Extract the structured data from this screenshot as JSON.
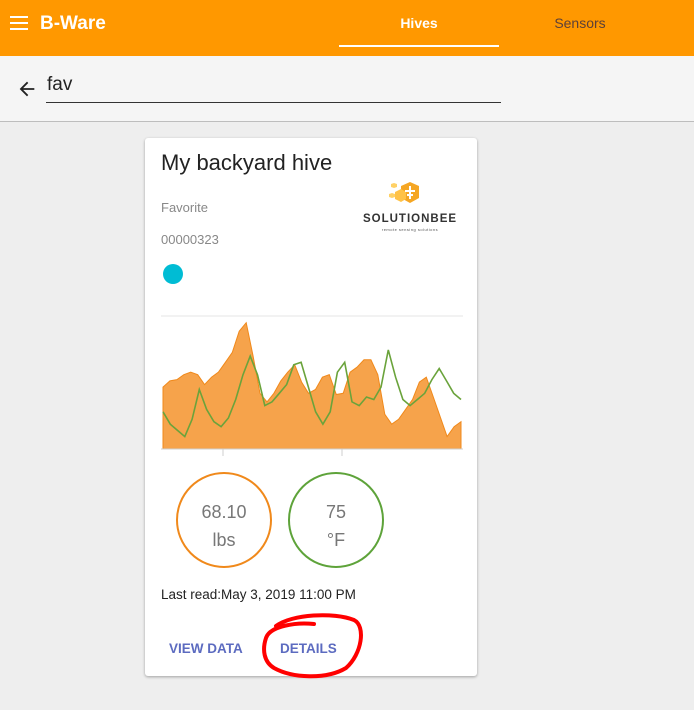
{
  "app": {
    "title": "B-Ware"
  },
  "tabs": [
    {
      "label": "Hives",
      "active": true
    },
    {
      "label": "Sensors",
      "active": false
    }
  ],
  "search": {
    "value": "fav"
  },
  "card": {
    "name": "My backyard hive",
    "subtitle": "Favorite",
    "id": "00000323",
    "status_color": "#00bcd4",
    "logo": {
      "name": "SOLUTIONBEE",
      "tagline": "remote sensing solutions"
    },
    "gauges": [
      {
        "value": "68.10",
        "unit": "lbs",
        "color": "#f0891b"
      },
      {
        "value": "75",
        "unit": "°F",
        "color": "#5ea33a"
      }
    ],
    "last_read": "Last read:May 3, 2019 11:00 PM",
    "actions": {
      "view_data": "VIEW DATA",
      "details": "DETAILS"
    }
  },
  "chart_data": {
    "type": "area",
    "x": [
      0,
      1,
      2,
      3,
      4,
      5,
      6,
      7,
      8,
      9,
      10,
      11,
      12,
      13,
      14,
      15,
      16,
      17,
      18,
      19,
      20,
      21,
      22,
      23,
      24,
      25,
      26,
      27,
      28,
      29,
      30,
      31,
      32,
      33,
      34,
      35,
      36,
      37,
      38,
      39,
      40,
      41,
      42,
      43,
      44,
      45,
      46,
      47,
      48,
      49,
      50
    ],
    "series": [
      {
        "color": "#f0891b",
        "values": [
          50,
          55,
          56,
          60,
          62,
          60,
          52,
          58,
          62,
          70,
          78,
          95,
          102,
          75,
          45,
          38,
          45,
          55,
          62,
          68,
          54,
          45,
          48,
          58,
          60,
          44,
          45,
          62,
          66,
          72,
          72,
          60,
          28,
          20,
          24,
          32,
          40,
          54,
          58,
          42,
          26,
          10,
          18,
          22
        ]
      },
      {
        "color": "#6aa33b",
        "values": [
          30,
          20,
          15,
          10,
          24,
          48,
          32,
          22,
          18,
          25,
          40,
          60,
          75,
          60,
          35,
          38,
          45,
          52,
          68,
          70,
          50,
          30,
          20,
          30,
          62,
          70,
          38,
          35,
          42,
          40,
          50,
          80,
          58,
          40,
          35,
          40,
          45,
          56,
          65,
          55,
          45,
          40
        ]
      }
    ]
  }
}
